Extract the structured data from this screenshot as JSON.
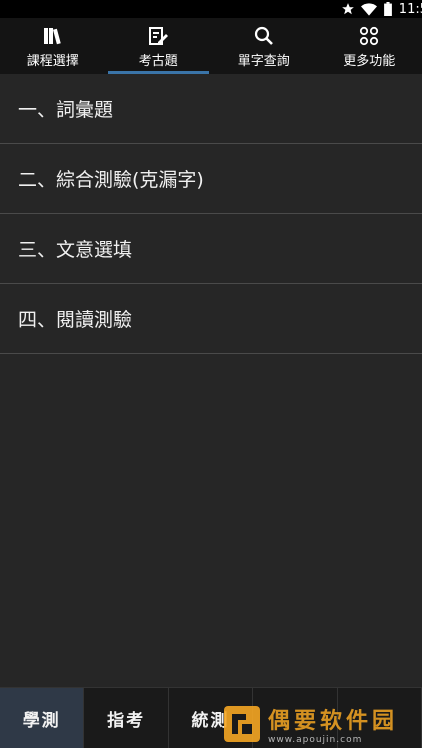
{
  "status_bar": {
    "time": "11:5"
  },
  "top_tabs": [
    {
      "label": "課程選擇",
      "icon": "books-icon"
    },
    {
      "label": "考古題",
      "icon": "edit-note-icon",
      "selected": true
    },
    {
      "label": "單字查詢",
      "icon": "search-icon"
    },
    {
      "label": "更多功能",
      "icon": "grid-icon"
    }
  ],
  "list_items": [
    {
      "label": "一、詞彙題"
    },
    {
      "label": "二、綜合測驗(克漏字)"
    },
    {
      "label": "三、文意選填"
    },
    {
      "label": "四、閱讀測驗"
    }
  ],
  "bottom_tabs": [
    {
      "label": "學測",
      "selected": true
    },
    {
      "label": "指考"
    },
    {
      "label": "統測"
    },
    {
      "label": ""
    },
    {
      "label": ""
    }
  ],
  "watermark": {
    "title": "偶要软件园",
    "url": "www.apoujin.com"
  },
  "colors": {
    "background": "#262626",
    "tab_bar": "#141414",
    "indicator": "#3a74a8",
    "bottom_active": "#2f3947"
  }
}
